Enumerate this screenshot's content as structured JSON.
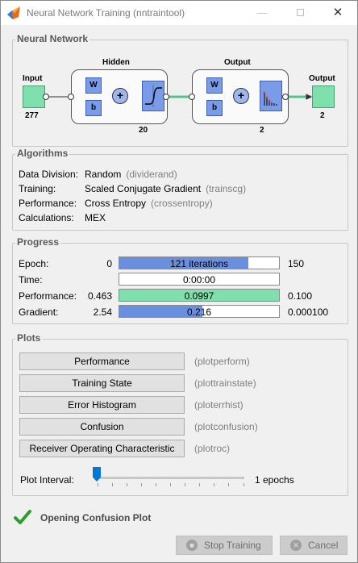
{
  "window": {
    "title": "Neural Network Training (nntraintool)",
    "minimize_glyph": "—",
    "close_glyph": "✕"
  },
  "network": {
    "panel_title": "Neural Network",
    "input_label": "Input",
    "input_size": "277",
    "hidden_label": "Hidden",
    "hidden_size": "20",
    "output_layer_label": "Output",
    "output_layer_size": "2",
    "output_label": "Output",
    "output_size": "2",
    "w_label": "W",
    "b_label": "b",
    "sum_glyph": "+"
  },
  "algorithms": {
    "panel_title": "Algorithms",
    "rows": [
      {
        "key": "Data Division:",
        "value": "Random",
        "fn": "(dividerand)"
      },
      {
        "key": "Training:",
        "value": "Scaled Conjugate Gradient",
        "fn": "(trainscg)"
      },
      {
        "key": "Performance:",
        "value": "Cross Entropy",
        "fn": "(crossentropy)"
      },
      {
        "key": "Calculations:",
        "value": "MEX",
        "fn": ""
      }
    ]
  },
  "progress": {
    "panel_title": "Progress",
    "rows": [
      {
        "label": "Epoch:",
        "min": "0",
        "text": "121 iterations",
        "max": "150",
        "fill": 0.8067,
        "color": "#6b8fdf"
      },
      {
        "label": "Time:",
        "min": "",
        "text": "0:00:00",
        "max": "",
        "fill": 0,
        "color": "#6b8fdf"
      },
      {
        "label": "Performance:",
        "min": "0.463",
        "text": "0.0997",
        "max": "0.100",
        "fill": 1.0,
        "color": "#7fe0ad"
      },
      {
        "label": "Gradient:",
        "min": "2.54",
        "text": "0.216",
        "max": "0.000100",
        "fill": 0.52,
        "color": "#6b8fdf"
      }
    ]
  },
  "plots": {
    "panel_title": "Plots",
    "buttons": [
      {
        "label": "Performance",
        "fn": "(plotperform)"
      },
      {
        "label": "Training State",
        "fn": "(plottrainstate)"
      },
      {
        "label": "Error Histogram",
        "fn": "(ploterrhist)"
      },
      {
        "label": "Confusion",
        "fn": "(plotconfusion)"
      },
      {
        "label": "Receiver Operating Characteristic",
        "fn": "(plotroc)"
      }
    ],
    "interval_label": "Plot Interval:",
    "interval_value": "1 epochs"
  },
  "status": {
    "text": "Opening Confusion Plot"
  },
  "footer": {
    "stop_label": "Stop Training",
    "cancel_label": "Cancel",
    "stop_icon_glyph": "■",
    "cancel_icon_glyph": "✕"
  }
}
